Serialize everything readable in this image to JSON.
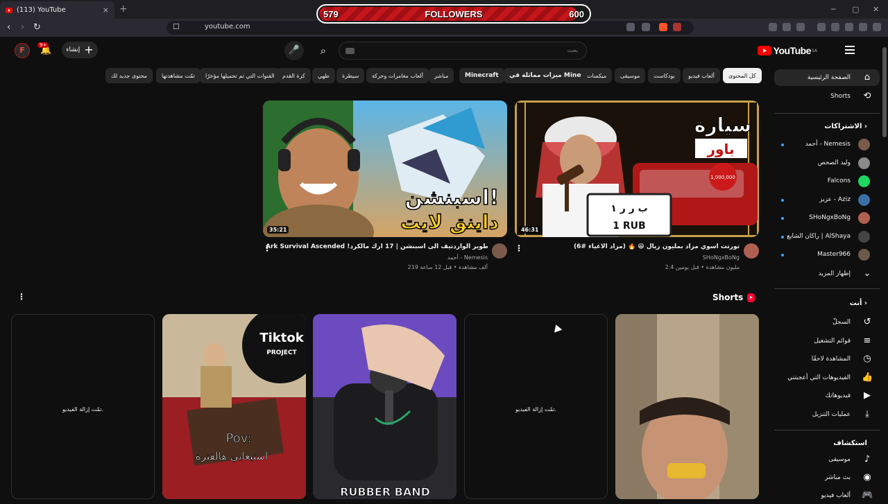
{
  "browser": {
    "tab_title": "(113) YouTube",
    "tab_close": "×",
    "new_tab": "+",
    "url": "youtube.com"
  },
  "overlay": {
    "followers_min": "579",
    "followers_label": "FOLLOWERS",
    "followers_max": "600"
  },
  "header": {
    "logo_text": "YouTube",
    "logo_region": "SA",
    "search_placeholder": "بحث",
    "create_label": "إنشاء",
    "notifications_badge": "9+"
  },
  "chips": [
    {
      "label": "كل المحتوى",
      "selected": true
    },
    {
      "label": "ألعاب فيديو"
    },
    {
      "label": "بودكاست"
    },
    {
      "label": "موسيقى"
    },
    {
      "label": "ميكسات"
    },
    {
      "label": "ميزات مماثلة في Minecraft"
    },
    {
      "label": "Minecraft"
    },
    {
      "label": "مباشر"
    },
    {
      "label": "ألعاب مغامرات وحركة"
    },
    {
      "label": "سيطرة"
    },
    {
      "label": "طهي"
    },
    {
      "label": "كرة القدم"
    },
    {
      "label": "القنوات التي تم تحميلها مؤخرًا"
    },
    {
      "label": "تمّت مشاهدتها"
    },
    {
      "label": "محتوى جديد لك"
    }
  ],
  "videos": [
    {
      "title": "(مزاد الاعياء #6) 🔥 😁 تورتت اسوي مزاد بمليون ريال",
      "channel": "SHoNgxBoNg",
      "meta": "2.4 مليون مشاهدة • قبل يومين",
      "duration": "46:31",
      "thumb_text": "سيارة باور"
    },
    {
      "title": "Ark Survival Ascended !تطوير الواردتيف الى اسبنشن | 17 ارك مالكرد",
      "channel": "أحمد - Nemesis",
      "meta": "219 ألف مشاهدة • قبل 12 ساعة",
      "duration": "35:21",
      "thumb_text": "اسبنشن! داينق لايت"
    }
  ],
  "shorts": {
    "title": "Shorts",
    "removed_text": "تمّت إزالة الفيديو.",
    "items": [
      {
        "type": "image",
        "caption": ""
      },
      {
        "type": "removed"
      },
      {
        "type": "image",
        "caption": "RUBBER BAND"
      },
      {
        "type": "image",
        "caption": "Pov: استيعابي هالفترة",
        "badge": "Tiktok PROJECT"
      },
      {
        "type": "removed"
      }
    ]
  },
  "sidebar": {
    "home": "الصفحة الرئيسية",
    "shorts": "Shorts",
    "subscriptions_head": "الاشتراكات",
    "subscriptions": [
      {
        "name": "أحمد - Nemesis",
        "dot": true,
        "color": "#7a5a4a"
      },
      {
        "name": "وليد الصحص",
        "dot": false,
        "color": "#8a8a8a"
      },
      {
        "name": "Falcons",
        "dot": false,
        "color": "#1ed760"
      },
      {
        "name": "عزيز - Aziz",
        "dot": true,
        "color": "#3a6ea5"
      },
      {
        "name": "SHoNgxBoNg",
        "dot": true,
        "color": "#b06050"
      },
      {
        "name": "راكان الشايع | AlShaya",
        "dot": true,
        "color": "#444444"
      },
      {
        "name": "Master966",
        "dot": true,
        "color": "#6b5a4a"
      }
    ],
    "show_more": "إظهار المزيد",
    "you_head": "أنت",
    "you_items": [
      {
        "label": "السجلّ",
        "icon": "history-icon"
      },
      {
        "label": "قوائم التشغيل",
        "icon": "playlist-icon"
      },
      {
        "label": "المشاهدة لاحقًا",
        "icon": "clock-icon"
      },
      {
        "label": "الفيديوهات التي أعجبتني",
        "icon": "thumb-up-icon"
      },
      {
        "label": "فيديوهاتك",
        "icon": "video-icon"
      },
      {
        "label": "عمليات التنزيل",
        "icon": "download-icon"
      }
    ],
    "explore_head": "استكشاف",
    "explore_items": [
      {
        "label": "موسيقى",
        "icon": "music-icon"
      },
      {
        "label": "بث مباشر",
        "icon": "live-icon"
      },
      {
        "label": "ألعاب فيديو",
        "icon": "gaming-icon"
      }
    ]
  },
  "colors": {
    "accent": "#ff0000",
    "background": "#0f0f0f",
    "chip": "#272727"
  }
}
